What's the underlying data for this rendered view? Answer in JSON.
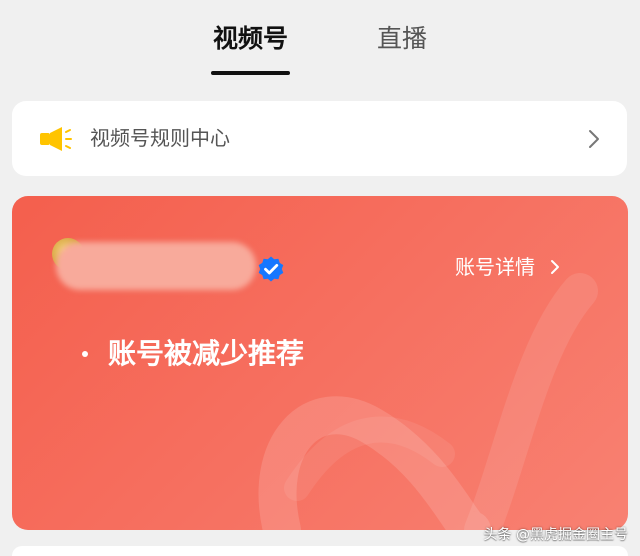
{
  "tabs": [
    {
      "label": "视频号",
      "active": true
    },
    {
      "label": "直播",
      "active": false
    }
  ],
  "rules_card": {
    "label": "视频号规则中心",
    "icon": "megaphone-icon",
    "chevron": "chevron-right-icon"
  },
  "account_card": {
    "details_label": "账号详情",
    "notice_text": "账号被减少推荐",
    "avatar_icon": "avatar",
    "verified_icon": "verified-badge-icon"
  },
  "footer": {
    "watermark": "头条 @黑虎掘金圈主号"
  },
  "colors": {
    "accent_red": "#f45f4d",
    "megaphone_yellow": "#ffc400",
    "verified_blue": "#1677ff"
  }
}
